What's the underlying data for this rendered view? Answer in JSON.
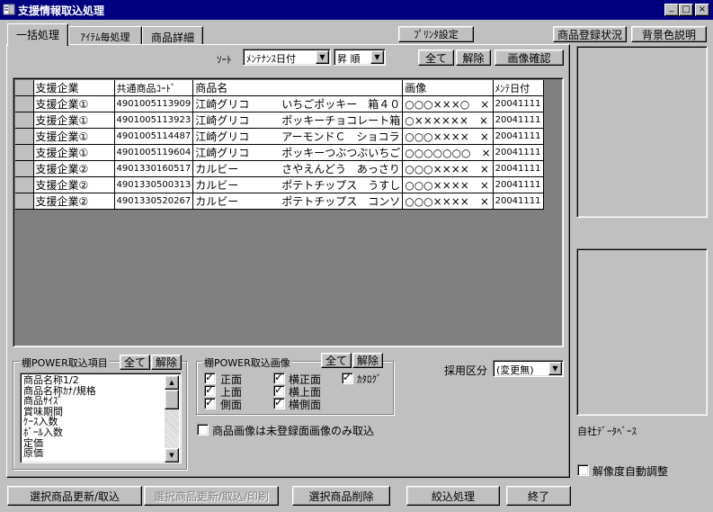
{
  "window": {
    "title": "支援情報取込処理",
    "controls": [
      "_",
      "□",
      "×"
    ]
  },
  "tabs": [
    {
      "label": "一括処理",
      "active": true
    },
    {
      "label": "ｱｲﾃﾑ毎処理",
      "active": false
    },
    {
      "label": "商品詳細",
      "active": false
    }
  ],
  "top_buttons": {
    "print_settings": "ﾌﾟﾘﾝﾀ設定",
    "product_registration_status": "商品登録状況",
    "background_color_description": "背景色説明"
  },
  "sort": {
    "label": "ｿｰﾄ",
    "field_value": "ﾒﾝﾃﾅﾝｽ日付",
    "order_value": "昇 順"
  },
  "grid_buttons": {
    "select_all": "全て",
    "deselect": "解除",
    "image_check": "画像確認"
  },
  "grid": {
    "headers": [
      "支援企業",
      "共通商品ｺｰﾄﾞ",
      "商品名",
      "画像",
      "ﾒﾝﾃ日付"
    ],
    "rows": [
      {
        "company": "支援企業①",
        "code": "4901005113909",
        "maker": "江崎グリコ",
        "name": "いちごポッキー　箱４０",
        "image": "○○○×××○　×",
        "date": "20041111"
      },
      {
        "company": "支援企業①",
        "code": "4901005113923",
        "maker": "江崎グリコ",
        "name": "ポッキーチョコレート箱",
        "image": "○××××××　×",
        "date": "20041111"
      },
      {
        "company": "支援企業①",
        "code": "4901005114487",
        "maker": "江崎グリコ",
        "name": "アーモンドＣ　ショコラ",
        "image": "○○○××××　×",
        "date": "20041111"
      },
      {
        "company": "支援企業①",
        "code": "4901005119604",
        "maker": "江崎グリコ",
        "name": "ポッキーつぶつぶいちご",
        "image": "○○○○○○○　×",
        "date": "20041111"
      },
      {
        "company": "支援企業②",
        "code": "4901330160517",
        "maker": "カルビー",
        "name": "さやえんどう　あっさり",
        "image": "○○○××××　×",
        "date": "20041111"
      },
      {
        "company": "支援企業②",
        "code": "4901330500313",
        "maker": "カルビー",
        "name": "ポテトチップス　うすし",
        "image": "○○○××××　×",
        "date": "20041111"
      },
      {
        "company": "支援企業②",
        "code": "4901330520267",
        "maker": "カルビー",
        "name": "ポテトチップス　コンソ",
        "image": "○○○××××　×",
        "date": "20041111"
      }
    ]
  },
  "import_items": {
    "title": "棚POWER取込項目",
    "select_all": "全て",
    "deselect": "解除",
    "items": [
      "商品名称1/2",
      "商品名称ｶﾅ/規格",
      "商品ｻｲｽﾞ",
      "賞味期間",
      "ｹｰｽ入数",
      "ﾎﾞｰﾙ入数",
      "定価",
      "原価"
    ]
  },
  "import_images": {
    "title": "棚POWER取込画像",
    "select_all": "全て",
    "deselect": "解除",
    "checkboxes": [
      {
        "label": "正面",
        "checked": true
      },
      {
        "label": "横正面",
        "checked": true
      },
      {
        "label": "ｶﾀﾛｸﾞ",
        "checked": true
      },
      {
        "label": "上面",
        "checked": true
      },
      {
        "label": "横上面",
        "checked": true
      },
      {
        "label": "側面",
        "checked": true
      },
      {
        "label": "横側面",
        "checked": true
      }
    ]
  },
  "unregistered_only": {
    "label": "商品画像は未登録面画像のみ取込",
    "checked": false
  },
  "adoption": {
    "label": "採用区分",
    "value": "(変更無)"
  },
  "right_panel": {
    "database_label": "自社ﾃﾞｰﾀﾍﾞｰｽ",
    "auto_resolution": {
      "label": "解像度自動調整",
      "checked": false
    }
  },
  "bottom_buttons": {
    "update_import": "選択商品更新/取込",
    "update_import_print": "選択商品更新/取込/印刷",
    "delete": "選択商品削除",
    "filter": "絞込処理",
    "exit": "終了"
  }
}
